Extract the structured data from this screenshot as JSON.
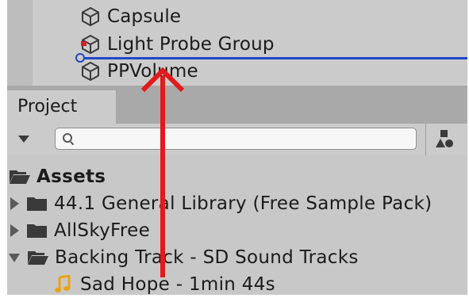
{
  "hierarchy": {
    "items": [
      {
        "label": "Capsule",
        "icon": "cube-icon"
      },
      {
        "label": "Light Probe Group",
        "icon": "light-probe-cube-icon"
      },
      {
        "label": "PPVolume",
        "icon": "cube-icon"
      }
    ],
    "drop_indicator_color": "#2147c9"
  },
  "project": {
    "tab_label": "Project",
    "search": {
      "value": "",
      "placeholder": ""
    },
    "tree": {
      "root": {
        "label": "Assets",
        "icon": "open-folder-icon"
      },
      "items": [
        {
          "label": "44.1 General Library (Free Sample Pack)",
          "icon": "folder-icon",
          "expanded": false
        },
        {
          "label": "AllSkyFree",
          "icon": "folder-icon",
          "expanded": false
        },
        {
          "label": "Backing Track - SD Sound Tracks",
          "icon": "open-folder-icon",
          "expanded": true
        },
        {
          "label": "Sad Hope - 1min 44s",
          "icon": "audio-file-icon"
        }
      ]
    }
  },
  "annotation": {
    "drag_arrow_color": "#e11b1b"
  },
  "colors": {
    "audio_icon": "#e8a317"
  }
}
